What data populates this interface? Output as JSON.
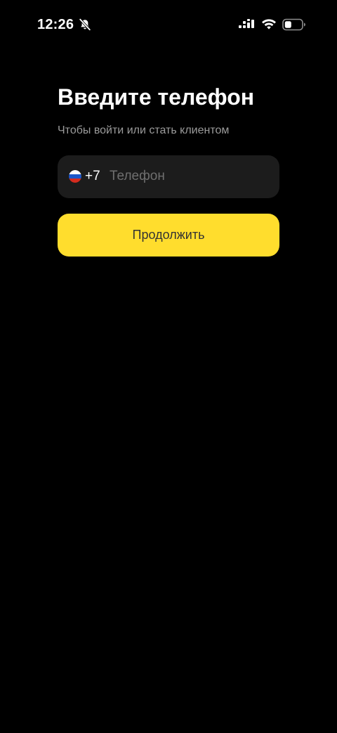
{
  "status_bar": {
    "time": "12:26",
    "icons": [
      "bell-off-icon",
      "cellular-icon",
      "wifi-icon",
      "battery-icon"
    ]
  },
  "login": {
    "title": "Введите телефон",
    "subtitle": "Чтобы войти или стать клиентом",
    "country_flag": "russia-flag-icon",
    "country_code": "+7",
    "phone_value": "",
    "phone_placeholder": "Телефон",
    "continue_label": "Продолжить"
  },
  "colors": {
    "background": "#000000",
    "field_background": "#1c1c1c",
    "accent": "#ffdd2d",
    "subtitle_text": "#9b9b9b",
    "placeholder_text": "#6f6f6f",
    "button_text": "#333333"
  }
}
